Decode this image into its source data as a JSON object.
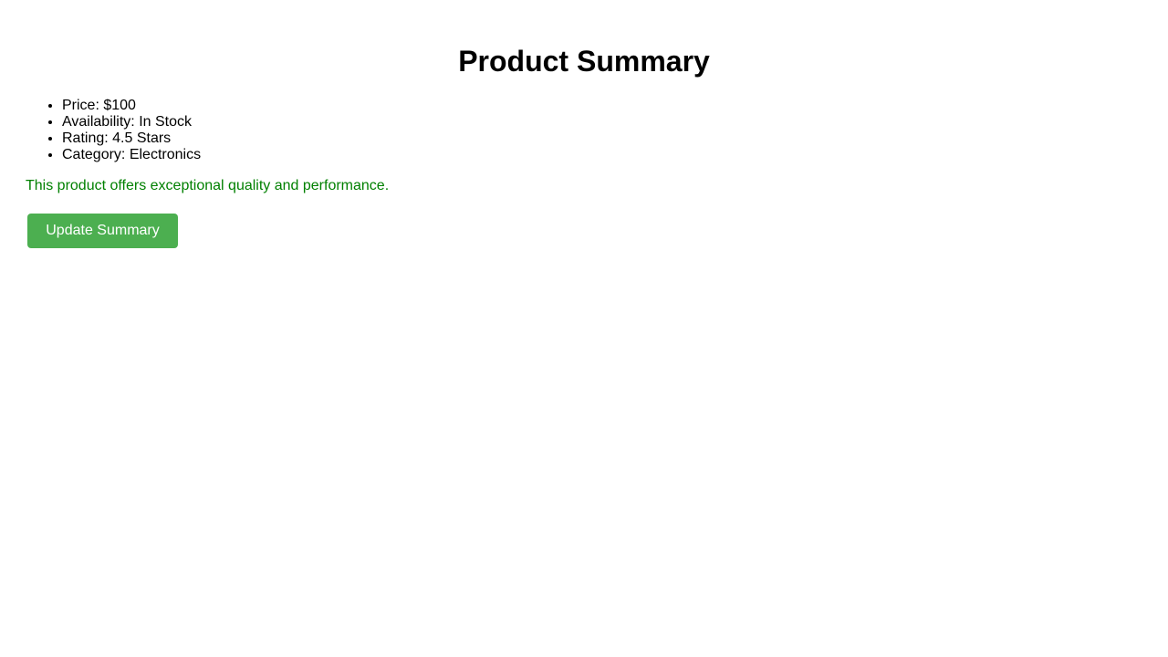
{
  "page": {
    "title": "Product Summary"
  },
  "details": {
    "items": [
      {
        "text": "Price: $100"
      },
      {
        "text": "Availability: In Stock"
      },
      {
        "text": "Rating: 4.5 Stars"
      },
      {
        "text": "Category: Electronics"
      }
    ]
  },
  "summary": {
    "text": "This product offers exceptional quality and performance.",
    "color": "#008000"
  },
  "actions": {
    "update_label": "Update Summary",
    "update_color": "#4caf50"
  }
}
